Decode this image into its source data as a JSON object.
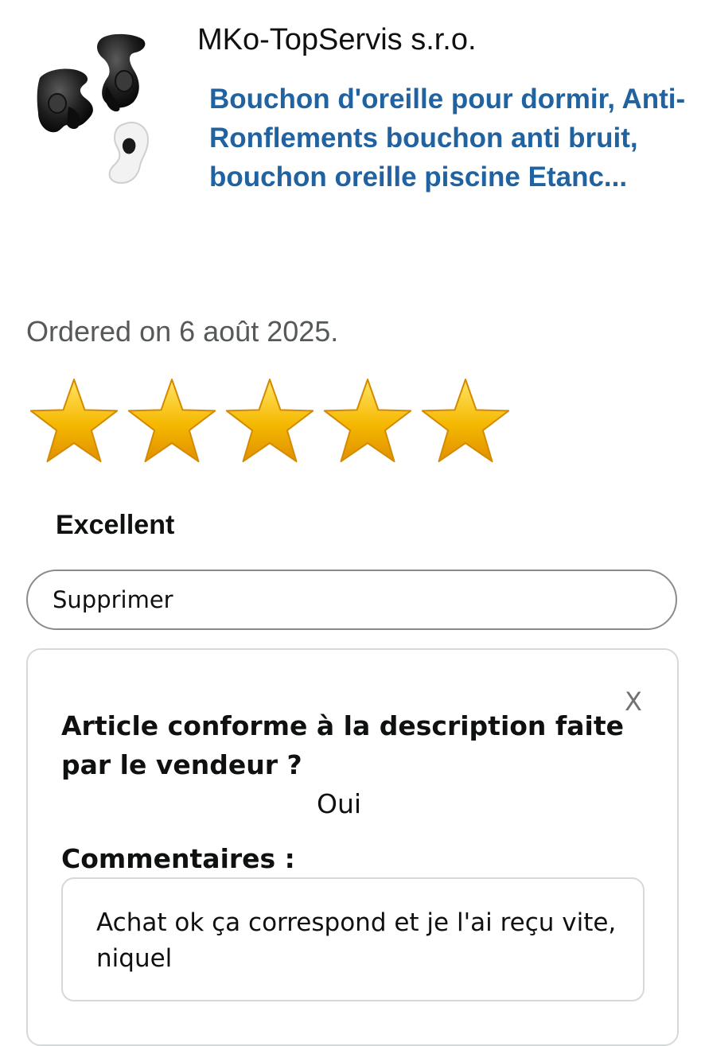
{
  "product": {
    "seller": "MKo-TopServis s.r.o.",
    "title": "Bouchon d'oreille pour dormir, Anti-Ronflements bouchon anti bruit, bouchon oreille piscine Etanc..."
  },
  "order": {
    "date_text": "Ordered on 6 août 2025."
  },
  "rating": {
    "stars": 5,
    "max": 5,
    "label": "Excellent",
    "star_color": "#f5b800"
  },
  "actions": {
    "delete_label": "Supprimer"
  },
  "feedback": {
    "close_label": "X",
    "question": "Article conforme à la description faite par le vendeur ?",
    "answer": "Oui",
    "comments_label": "Commentaires :",
    "comment": "Achat ok ça correspond et je l'ai reçu vite, niquel"
  },
  "colors": {
    "link": "#2162a1",
    "secondary_text": "#565959"
  }
}
